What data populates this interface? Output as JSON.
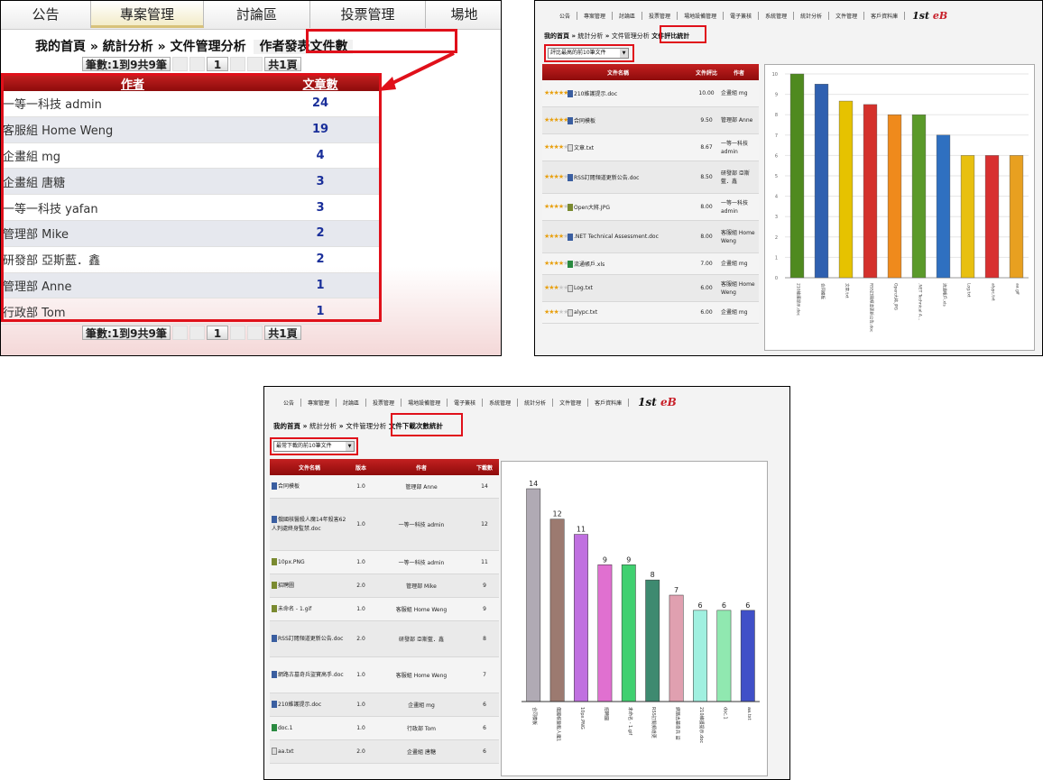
{
  "panel_a": {
    "nav": [
      "公告",
      "專案管理",
      "討論區",
      "投票管理",
      "場地"
    ],
    "active_nav": 1,
    "breadcrumb": {
      "home": "我的首頁",
      "sep": "»",
      "analysis": "統計分析",
      "file_mgmt": "文件管理分析",
      "current": "作者發表文件數"
    },
    "pager": {
      "summary": "筆數:1到9共9筆",
      "page": "1",
      "total": "共1頁"
    },
    "table": {
      "headers": [
        "作者",
        "文章數"
      ],
      "rows": [
        [
          "一等一科技 admin",
          "24"
        ],
        [
          "客服組 Home Weng",
          "19"
        ],
        [
          "企畫組 mg",
          "4"
        ],
        [
          "企畫組 唐糖",
          "3"
        ],
        [
          "一等一科技 yafan",
          "3"
        ],
        [
          "管理部 Mike",
          "2"
        ],
        [
          "研發部 亞斯藍．鑫",
          "2"
        ],
        [
          "管理部 Anne",
          "1"
        ],
        [
          "行政部 Tom",
          "1"
        ]
      ]
    }
  },
  "panel_b": {
    "nav": [
      "公告",
      "專案管理",
      "討論區",
      "投票管理",
      "場地設備管理",
      "電子簽核",
      "系統管理",
      "統計分析",
      "文件管理",
      "客戶資料庫"
    ],
    "logo": {
      "main": "1st ",
      "accent": "eB"
    },
    "breadcrumb": {
      "home": "我的首頁",
      "sep": "»",
      "analysis": "統計分析",
      "file_mgmt": "文件管理分析",
      "current": "文件評比統計"
    },
    "select": "評比最高的前10筆文件",
    "table": {
      "headers": [
        "文件名稱",
        "文件評比",
        "作者"
      ],
      "rows": [
        {
          "file": "210維護提示.doc",
          "score": "10.00",
          "author": "企畫組 mg",
          "icon": "doc",
          "stars": 5
        },
        {
          "file": "合同模板",
          "score": "9.50",
          "author": "管理部 Anne",
          "icon": "doc",
          "stars": 5
        },
        {
          "file": "文章.txt",
          "score": "8.67",
          "author": "一等一科技 admin",
          "icon": "txt",
          "stars": 4
        },
        {
          "file": "RSS訂閱頻道更新公告.doc",
          "score": "8.50",
          "author": "研發部 亞斯藍．鑫",
          "icon": "doc",
          "stars": 4
        },
        {
          "file": "Open大將.JPG",
          "score": "8.00",
          "author": "一等一科技 admin",
          "icon": "img",
          "stars": 4
        },
        {
          "file": ".NET Technical Assessment.doc",
          "score": "8.00",
          "author": "客服組 Home Weng",
          "icon": "doc",
          "stars": 4
        },
        {
          "file": "流通帳戶.xls",
          "score": "7.00",
          "author": "企畫組 mg",
          "icon": "xls",
          "stars": 4
        },
        {
          "file": "Log.txt",
          "score": "6.00",
          "author": "客服組 Home Weng",
          "icon": "txt",
          "stars": 3
        },
        {
          "file": "alypc.txt",
          "score": "6.00",
          "author": "企畫組 mg",
          "icon": "txt",
          "stars": 3
        }
      ]
    }
  },
  "panel_c": {
    "nav": [
      "公告",
      "專案管理",
      "討論區",
      "投票管理",
      "場地設備管理",
      "電子簽核",
      "系統管理",
      "統計分析",
      "文件管理",
      "客戶資料庫"
    ],
    "logo": {
      "main": "1st ",
      "accent": "eB"
    },
    "breadcrumb": {
      "home": "我的首頁",
      "sep": "»",
      "analysis": "統計分析",
      "file_mgmt": "文件管理分析",
      "current": "文件下載次數統計"
    },
    "select": "最常下載的前10筆文件",
    "table": {
      "headers": [
        "文件名稱",
        "版本",
        "作者",
        "下載數"
      ],
      "rows": [
        {
          "file": "合同模板",
          "ver": "1.0",
          "author": "管理部 Anne",
          "count": "14",
          "icon": "doc"
        },
        {
          "file": "俄國核醫殺人魔14年殺害62人判處終身監禁.doc",
          "ver": "1.0",
          "author": "一等一科技 admin",
          "count": "12",
          "icon": "doc"
        },
        {
          "file": "10px.PNG",
          "ver": "1.0",
          "author": "一等一科技 admin",
          "count": "11",
          "icon": "img"
        },
        {
          "file": "招聘圖",
          "ver": "2.0",
          "author": "管理部 Mike",
          "count": "9",
          "icon": "img"
        },
        {
          "file": "未命名 - 1.gif",
          "ver": "1.0",
          "author": "客服組 Home Weng",
          "count": "9",
          "icon": "img"
        },
        {
          "file": "RSS訂閱頻道更新公告.doc",
          "ver": "2.0",
          "author": "研發部 亞斯藍．鑫",
          "count": "8",
          "icon": "doc"
        },
        {
          "file": "網路古墓奇兵盜寶高手.doc",
          "ver": "1.0",
          "author": "客服組 Home Weng",
          "count": "7",
          "icon": "doc"
        },
        {
          "file": "210維護提示.doc",
          "ver": "1.0",
          "author": "企畫組 mg",
          "count": "6",
          "icon": "doc"
        },
        {
          "file": "doc.1",
          "ver": "1.0",
          "author": "行政部 Tom",
          "count": "6",
          "icon": "xls"
        },
        {
          "file": "aa.txt",
          "ver": "2.0",
          "author": "企畫組 唐糖",
          "count": "6",
          "icon": "txt"
        }
      ]
    }
  },
  "chart_data": [
    {
      "type": "bar",
      "categories": [
        "210維護提示.doc",
        "合同模板",
        "文章.txt",
        "RSS訂閱頻道更新公告.doc",
        "Open大將.JPG",
        ".NET Technical A...",
        "流通帳戶.xls",
        "Log.txt",
        "alypc.txt",
        "aa.gif"
      ],
      "values": [
        10,
        9.5,
        8.67,
        8.5,
        8,
        8,
        7,
        6,
        6,
        6
      ],
      "ylim": [
        0,
        10
      ],
      "yticks": [
        "0",
        "1",
        "2",
        "3",
        "4",
        "5",
        "6",
        "7",
        "8",
        "9",
        "10"
      ],
      "colors": [
        "#4f8a1f",
        "#2f60b0",
        "#e6c200",
        "#d4312c",
        "#ef8a1c",
        "#5a9a2a",
        "#2f70c0",
        "#e8c010",
        "#d83030",
        "#e8a020"
      ],
      "grid": true
    },
    {
      "type": "bar",
      "categories": [
        "合同模板",
        "俄國核醫殺人魔1",
        "10px.PNG",
        "招聘圖",
        "未命名 - 1.gif",
        "RSS訂閱頻道更",
        "網路古墓奇兵 盜",
        "210維護提示.doc",
        "doc.1",
        "aa.txt"
      ],
      "values": [
        14,
        12,
        11,
        9,
        9,
        8,
        7,
        6,
        6,
        6
      ],
      "data_labels": [
        "14",
        "12",
        "11",
        "9",
        "9",
        "8",
        "7",
        "6",
        "6",
        "6"
      ],
      "ylim": [
        0,
        14
      ],
      "colors": [
        "#b0aab4",
        "#9c7a70",
        "#c070e0",
        "#e070d0",
        "#40d070",
        "#3e8a70",
        "#e0a0b0",
        "#a0f0e0",
        "#90e8b0",
        "#4050c8"
      ],
      "grid": false
    }
  ]
}
